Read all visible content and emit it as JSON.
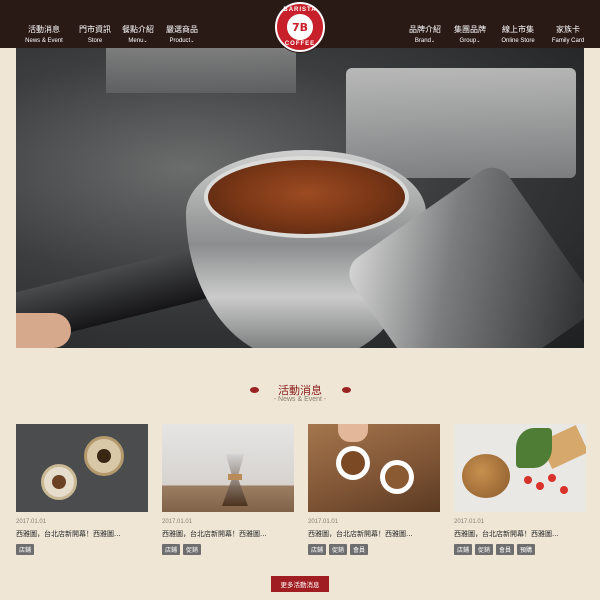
{
  "nav_left": [
    {
      "zh": "活動消息",
      "en": "News & Event",
      "chevron": false
    },
    {
      "zh": "門市資訊",
      "en": "Store",
      "chevron": false
    },
    {
      "zh": "餐點介紹",
      "en": "Menu",
      "chevron": true
    },
    {
      "zh": "嚴選商品",
      "en": "Product",
      "chevron": true
    }
  ],
  "nav_right": [
    {
      "zh": "品牌介紹",
      "en": "Brand",
      "chevron": true
    },
    {
      "zh": "集團品牌",
      "en": "Group",
      "chevron": true
    },
    {
      "zh": "線上市集",
      "en": "Online Store",
      "chevron": false
    },
    {
      "zh": "家族卡",
      "en": "Family Card",
      "chevron": false
    }
  ],
  "logo": {
    "top": "BARISTA",
    "bottom": "COFFEE",
    "mark": "7B"
  },
  "hero": {
    "slides": 5,
    "active": 1
  },
  "section": {
    "title": "活動消息",
    "subtitle": "- News & Event -"
  },
  "cards": [
    {
      "date": "2017.01.01",
      "title": "西雅圖，台北店新開幕！西雅圖...",
      "tags": [
        "店鋪"
      ]
    },
    {
      "date": "2017.01.01",
      "title": "西雅圖，台北店新開幕！西雅圖...",
      "tags": [
        "店鋪",
        "促銷"
      ]
    },
    {
      "date": "2017.01.01",
      "title": "西雅圖，台北店新開幕！西雅圖...",
      "tags": [
        "店鋪",
        "促銷",
        "會員"
      ]
    },
    {
      "date": "2017.01.01",
      "title": "西雅圖，台北店新開幕！西雅圖...",
      "tags": [
        "店鋪",
        "促銷",
        "會員",
        "預購"
      ]
    }
  ],
  "more_button": "更多活動消息",
  "chevron_glyph": "⌄"
}
